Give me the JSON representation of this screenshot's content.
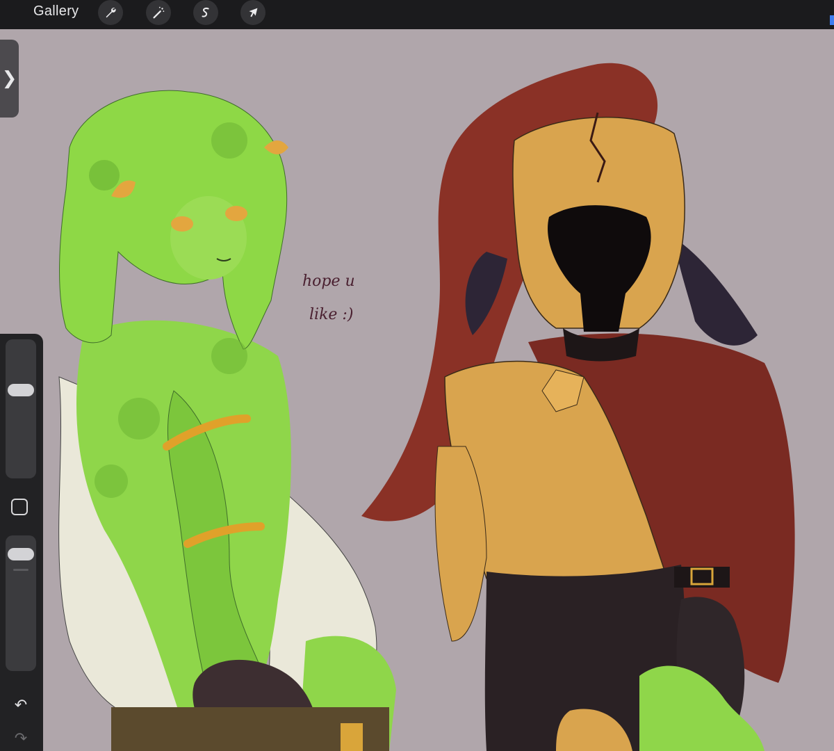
{
  "app": {
    "gallery_label": "Gallery",
    "accent_color": "#3f7df0",
    "canvas_bg": "#b0a6ab"
  },
  "toolbar": {
    "tools": [
      {
        "name": "actions",
        "icon": "wrench-icon"
      },
      {
        "name": "adjustments",
        "icon": "magic-wand-icon"
      },
      {
        "name": "selection",
        "icon": "selection-s-icon"
      },
      {
        "name": "transform",
        "icon": "arrow-cursor-icon"
      }
    ]
  },
  "sidebar": {
    "brush_size_level": 0.65,
    "opacity_level": 0.9,
    "tab_glyph": "❯",
    "undo_glyph": "↶",
    "redo_glyph": "↷"
  },
  "canvas": {
    "handwritten_note_line1": "hope u",
    "handwritten_note_line2": "like :)"
  }
}
